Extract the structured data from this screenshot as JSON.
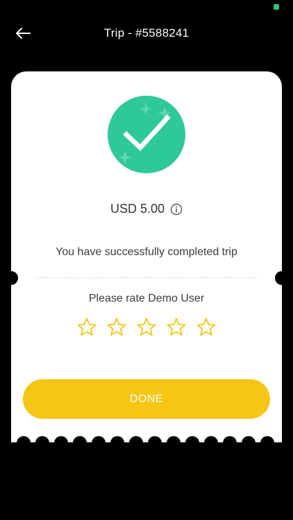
{
  "header": {
    "title": "Trip - #5588241"
  },
  "trip": {
    "amount": "USD 5.00",
    "message": "You have successfully completed trip",
    "rate_prompt": "Please rate Demo User",
    "rating": 0,
    "max_rating": 5
  },
  "actions": {
    "done_label": "DONE"
  },
  "colors": {
    "success": "#2ec89a",
    "accent": "#f7c514",
    "star_outline": "#f2c515",
    "battery": "#2ec27e"
  },
  "icons": {
    "back": "arrow-left-icon",
    "success": "checkmark-icon",
    "info": "info-icon",
    "star": "star-outline-icon"
  }
}
